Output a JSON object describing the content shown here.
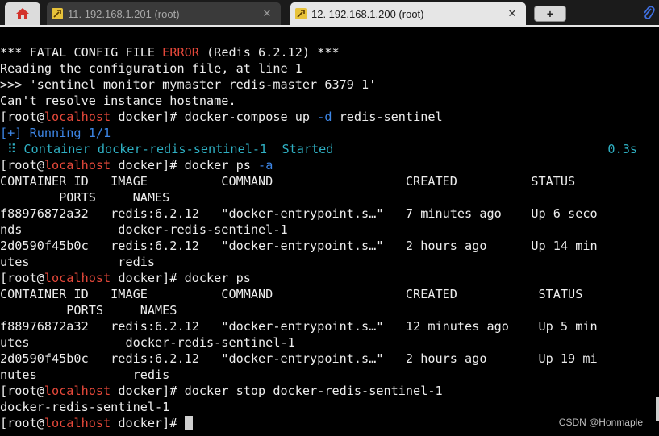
{
  "tabs": [
    {
      "label": "11. 192.168.1.201 (root)",
      "active": false
    },
    {
      "label": "12. 192.168.1.200 (root)",
      "active": true
    }
  ],
  "close_glyph": "✕",
  "new_tab_glyph": "+",
  "icons": {
    "home": "home-icon",
    "terminal": "terminal-icon",
    "attach": "paperclip-icon"
  },
  "colors": {
    "background": "#000000",
    "text": "#ededed",
    "error": "#e5483a",
    "hostname": "#e5483a",
    "flag": "#3d86e6",
    "status": "#2fb0c3"
  },
  "prompt": {
    "prefix": "[root@",
    "host": "localhost",
    "suffix": " docker]# "
  },
  "terminal": {
    "l1": {
      "a": "*** FATAL CONFIG FILE ",
      "b": "ERROR",
      "c": " (Redis 6.2.12) ***"
    },
    "l2": "Reading the configuration file, at line 1",
    "l3": ">>> 'sentinel monitor mymaster redis-master 6379 1'",
    "l4": "Can't resolve instance hostname.",
    "l5": {
      "a": "docker-compose up ",
      "b": "-d",
      "c": " redis-sentinel"
    },
    "l6": "[+] Running 1/1",
    "l7": {
      "a": " ⠿ Container docker-redis-sentinel-1  Started",
      "b": "0.3s"
    },
    "l8": {
      "a": "docker ps ",
      "b": "-a"
    },
    "l9": "CONTAINER ID   IMAGE          COMMAND                  CREATED          STATUS",
    "l10": "        PORTS     NAMES",
    "l11": "f88976872a32   redis:6.2.12   \"docker-entrypoint.s…\"   7 minutes ago    Up 6 seco",
    "l12": "nds             docker-redis-sentinel-1",
    "l13": "2d0590f45b0c   redis:6.2.12   \"docker-entrypoint.s…\"   2 hours ago      Up 14 min",
    "l14": "utes            redis",
    "l15": "docker ps",
    "l16": "CONTAINER ID   IMAGE          COMMAND                  CREATED           STATUS",
    "l17": "         PORTS     NAMES",
    "l18": "f88976872a32   redis:6.2.12   \"docker-entrypoint.s…\"   12 minutes ago    Up 5 min",
    "l19": "utes             docker-redis-sentinel-1",
    "l20": "2d0590f45b0c   redis:6.2.12   \"docker-entrypoint.s…\"   2 hours ago       Up 19 mi",
    "l21": "nutes             redis",
    "l22": "docker stop docker-redis-sentinel-1",
    "l23": "docker-redis-sentinel-1"
  },
  "watermark": "CSDN @Honmaple"
}
